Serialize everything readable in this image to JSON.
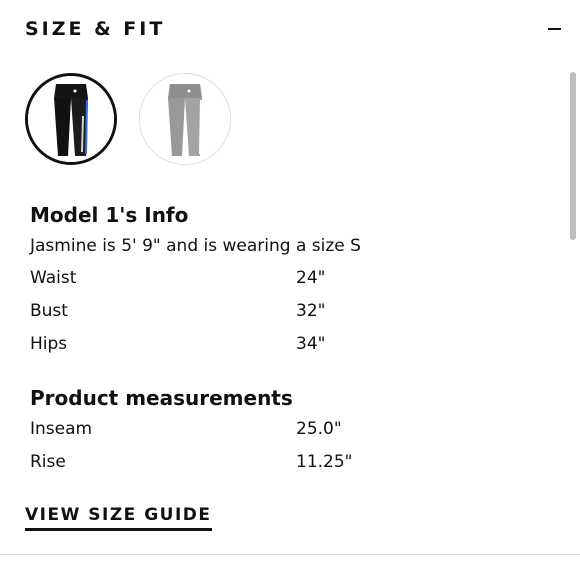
{
  "header": {
    "title": "SIZE & FIT",
    "collapse_icon": "minus-icon"
  },
  "swatches": [
    {
      "name": "leggings-black-swatch",
      "selected": true,
      "color": "#111111",
      "stripe": "#2f6fd6"
    },
    {
      "name": "leggings-grey-swatch",
      "selected": false,
      "color": "#9a9a9a",
      "stripe": "#ffffff"
    }
  ],
  "model_info": {
    "heading": "Model 1's Info",
    "description": "Jasmine is 5' 9\" and is wearing a size S",
    "rows": [
      {
        "label": "Waist",
        "value": "24\""
      },
      {
        "label": "Bust",
        "value": "32\""
      },
      {
        "label": "Hips",
        "value": "34\""
      }
    ]
  },
  "product_measurements": {
    "heading": "Product measurements",
    "rows": [
      {
        "label": "Inseam",
        "value": "25.0\""
      },
      {
        "label": "Rise",
        "value": "11.25\""
      }
    ]
  },
  "size_guide_link": "VIEW SIZE GUIDE"
}
